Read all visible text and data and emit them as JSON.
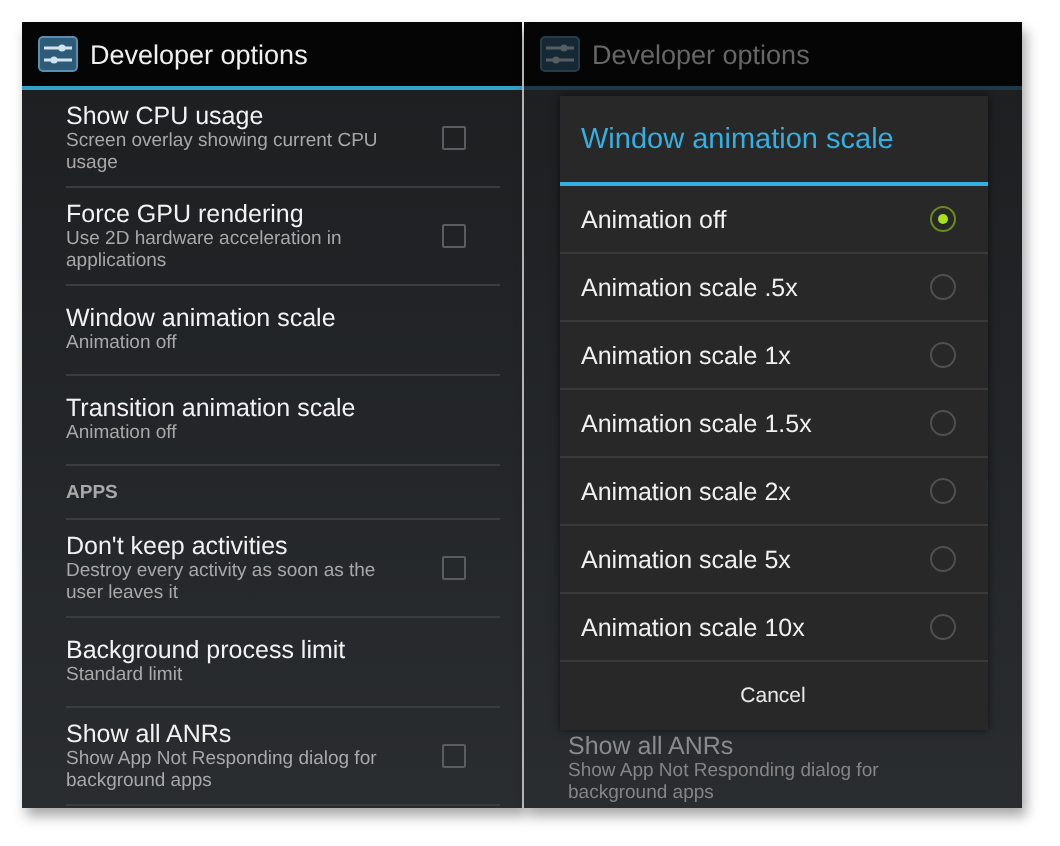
{
  "settings_screen": {
    "title": "Developer options",
    "items": [
      {
        "kind": "checkbox",
        "title": "Show CPU usage",
        "summary": "Screen overlay showing current CPU usage",
        "checked": false
      },
      {
        "kind": "checkbox",
        "title": "Force GPU rendering",
        "summary": "Use 2D hardware acceleration in applications",
        "checked": false
      },
      {
        "kind": "text",
        "title": "Window animation scale",
        "summary": "Animation off"
      },
      {
        "kind": "text",
        "title": "Transition animation scale",
        "summary": "Animation off"
      },
      {
        "kind": "section",
        "title": "APPS"
      },
      {
        "kind": "checkbox",
        "title": "Don't keep activities",
        "summary": "Destroy every activity as soon as the user leaves it",
        "checked": false
      },
      {
        "kind": "text",
        "title": "Background process limit",
        "summary": "Standard limit"
      },
      {
        "kind": "checkbox",
        "title": "Show all ANRs",
        "summary": "Show App Not Responding dialog for background apps",
        "checked": false
      }
    ]
  },
  "dialog_screen": {
    "title": "Developer options",
    "dialog": {
      "title": "Window animation scale",
      "options": [
        {
          "label": "Animation off",
          "selected": true
        },
        {
          "label": "Animation scale .5x",
          "selected": false
        },
        {
          "label": "Animation scale 1x",
          "selected": false
        },
        {
          "label": "Animation scale 1.5x",
          "selected": false
        },
        {
          "label": "Animation scale 2x",
          "selected": false
        },
        {
          "label": "Animation scale 5x",
          "selected": false
        },
        {
          "label": "Animation scale 10x",
          "selected": false
        }
      ],
      "cancel": "Cancel"
    },
    "items": [
      {
        "kind": "text",
        "title": "Show all ANRs",
        "summary": "Show App Not Responding dialog for background apps"
      }
    ]
  }
}
